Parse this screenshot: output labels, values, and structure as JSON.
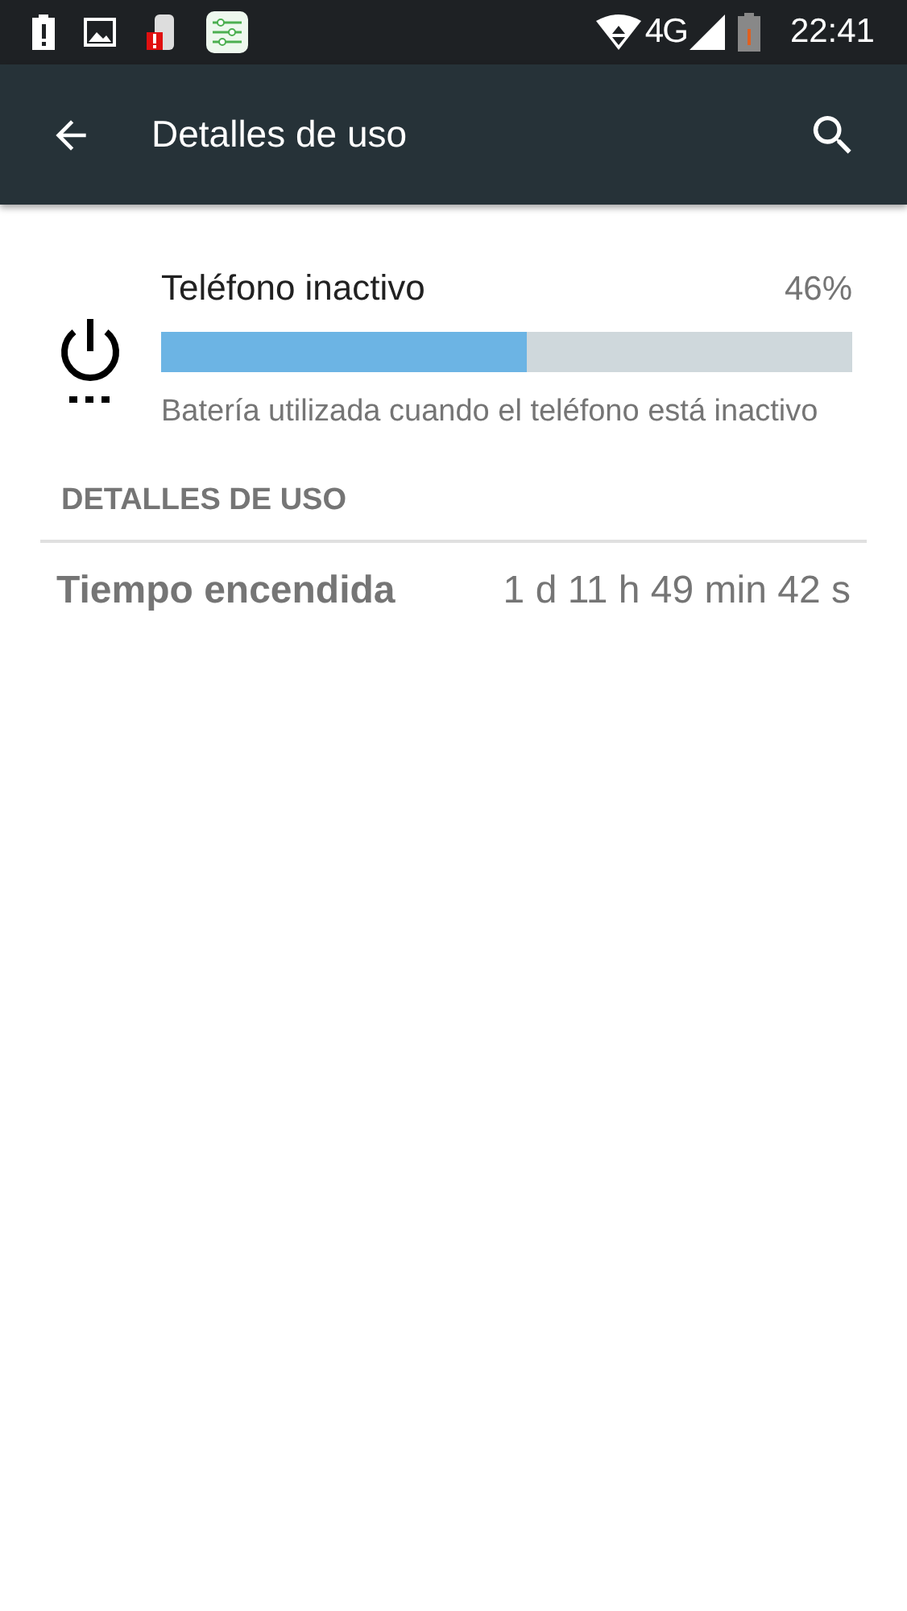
{
  "status_bar": {
    "network": "4G",
    "time": "22:41"
  },
  "app_bar": {
    "title": "Detalles de uso"
  },
  "usage": {
    "title": "Teléfono inactivo",
    "percent": "46%",
    "level": 0.53,
    "description": "Batería utilizada cuando el teléfono está inactivo"
  },
  "section": {
    "header": "DETALLES DE USO",
    "rows": [
      {
        "label": "Tiempo encendida",
        "value": "1 d 11 h 49 min 42 s"
      }
    ]
  }
}
